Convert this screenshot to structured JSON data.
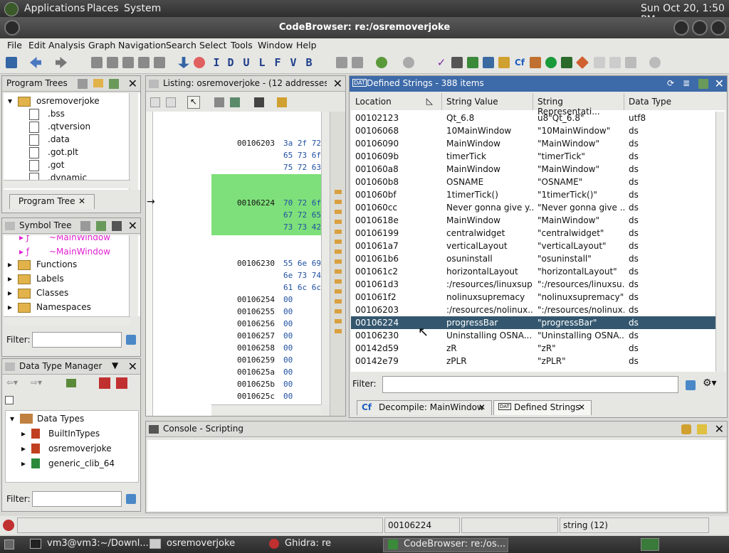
{
  "top_panel": {
    "menu_applications": "Applications",
    "menu_places": "Places",
    "menu_system": "System",
    "clock": "Sun Oct 20,  1:50 PM"
  },
  "window": {
    "title": "CodeBrowser: re:/osremoverjoke"
  },
  "menubar": [
    "File",
    "Edit",
    "Analysis",
    "Graph",
    "Navigation",
    "Search",
    "Select",
    "Tools",
    "Window",
    "Help"
  ],
  "program_trees": {
    "title": "Program Trees",
    "root": "osremoverjoke",
    "items": [
      ".bss",
      ".qtversion",
      ".data",
      ".got.plt",
      ".got",
      ".dynamic"
    ],
    "tab": "Program Tree"
  },
  "symbol_tree": {
    "title": "Symbol Tree",
    "items": [
      "~MainWindow",
      "~MainWindow",
      "Functions",
      "Labels",
      "Classes",
      "Namespaces"
    ],
    "filter_label": "Filter:"
  },
  "data_type_manager": {
    "title": "Data Type Manager",
    "root": "Data Types",
    "items": [
      "BuiltInTypes",
      "osremoverjoke",
      "generic_clib_64"
    ],
    "filter_label": "Filter:"
  },
  "listing": {
    "title": "Listing:  osremoverjoke - (12 addresses ...",
    "lines": [
      {
        "addr": "00106203",
        "bytes": "3a 2f 72"
      },
      {
        "addr": "",
        "bytes": "65 73 6f"
      },
      {
        "addr": "",
        "bytes": "75 72 63"
      },
      {
        "addr": "00106224",
        "bytes": "70 72 6f"
      },
      {
        "addr": "",
        "bytes": "67 72 65"
      },
      {
        "addr": "",
        "bytes": "73 73 42"
      },
      {
        "addr": "00106230",
        "bytes": "55 6e 69"
      },
      {
        "addr": "",
        "bytes": "6e 73 74"
      },
      {
        "addr": "",
        "bytes": "61 6c 6c"
      },
      {
        "addr": "00106254",
        "bytes": "00"
      },
      {
        "addr": "00106255",
        "bytes": "00"
      },
      {
        "addr": "00106256",
        "bytes": "00"
      },
      {
        "addr": "00106257",
        "bytes": "00"
      },
      {
        "addr": "00106258",
        "bytes": "00"
      },
      {
        "addr": "00106259",
        "bytes": "00"
      },
      {
        "addr": "0010625a",
        "bytes": "00"
      },
      {
        "addr": "0010625b",
        "bytes": "00"
      },
      {
        "addr": "0010625c",
        "bytes": "00"
      }
    ]
  },
  "defined_strings": {
    "title": "Defined Strings - 388 items",
    "columns": [
      "Location",
      "String Value",
      "String Representati...",
      "Data Type"
    ],
    "rows": [
      [
        "00102123",
        "Qt_6.8",
        "u8\"Qt_6.8\"",
        "utf8"
      ],
      [
        "00106068",
        "10MainWindow",
        "\"10MainWindow\"",
        "ds"
      ],
      [
        "00106090",
        "MainWindow",
        "\"MainWindow\"",
        "ds"
      ],
      [
        "0010609b",
        "timerTick",
        "\"timerTick\"",
        "ds"
      ],
      [
        "001060a8",
        "MainWindow",
        "\"MainWindow\"",
        "ds"
      ],
      [
        "001060b8",
        "OSNAME",
        "\"OSNAME\"",
        "ds"
      ],
      [
        "001060bf",
        "1timerTick()",
        "\"1timerTick()\"",
        "ds"
      ],
      [
        "001060cc",
        "Never gonna give y...",
        "\"Never gonna give ...",
        "ds"
      ],
      [
        "0010618e",
        "MainWindow",
        "\"MainWindow\"",
        "ds"
      ],
      [
        "00106199",
        "centralwidget",
        "\"centralwidget\"",
        "ds"
      ],
      [
        "001061a7",
        "verticalLayout",
        "\"verticalLayout\"",
        "ds"
      ],
      [
        "001061b6",
        "osuninstall",
        "\"osuninstall\"",
        "ds"
      ],
      [
        "001061c2",
        "horizontalLayout",
        "\"horizontalLayout\"",
        "ds"
      ],
      [
        "001061d3",
        ":/resources/linuxsup...",
        "\":/resources/linuxsu...",
        "ds"
      ],
      [
        "001061f2",
        "nolinuxsupremacy",
        "\"nolinuxsupremacy\"",
        "ds"
      ],
      [
        "00106203",
        ":/resources/nolinux...",
        "\":/resources/nolinux...",
        "ds"
      ],
      [
        "00106224",
        "progressBar",
        "\"progressBar\"",
        "ds"
      ],
      [
        "00106230",
        "Uninstalling OSNA...",
        "\"Uninstalling OSNA...",
        "ds"
      ],
      [
        "00142d59",
        "zR",
        "\"zR\"",
        "ds"
      ],
      [
        "00142e79",
        "zPLR",
        "\"zPLR\"",
        "ds"
      ]
    ],
    "selected_index": 16,
    "filter_label": "Filter:",
    "filter_value": ""
  },
  "bottom_tabs": [
    "Decompile: MainWindow",
    "Defined Strings"
  ],
  "console": {
    "title": "Console - Scripting"
  },
  "status": {
    "address": "00106224",
    "type": "string  (12)"
  },
  "taskbar": {
    "tasks": [
      "vm3@vm3:~/Downl...",
      "osremoverjoke",
      "Ghidra: re",
      "CodeBrowser: re:/os..."
    ]
  },
  "colors": {
    "selection": "#34576f",
    "listing_highlight": "#7ee07a",
    "symbol_pink": "#e020d0"
  }
}
